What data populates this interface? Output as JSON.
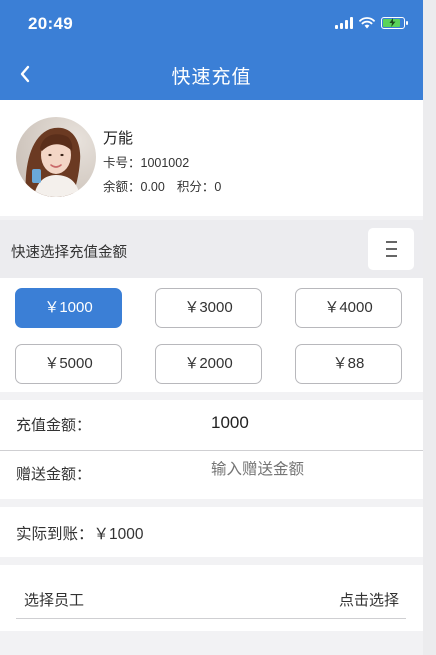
{
  "status_bar": {
    "time": "20:49",
    "icons": [
      "signal-icon",
      "wifi-icon",
      "battery-charging-icon"
    ]
  },
  "header": {
    "title": "快速充值",
    "back_icon": "chevron-left-icon",
    "color": "#3b7fd6"
  },
  "member": {
    "name": "万能",
    "card_no": "卡号：1001002",
    "balance": "余额：0.00",
    "points": "积分：0"
  },
  "quick_select": {
    "title": "快速选择充值金额",
    "menu_icon": "menu-lines-icon",
    "amounts": [
      "￥1000",
      "￥3000",
      "￥4000",
      "￥5000",
      "￥2000",
      "￥88"
    ],
    "selected_index": 0,
    "accent": "#3b7fd6"
  },
  "form": {
    "recharge_label": "充值金额：",
    "recharge_value": "1000",
    "gift_label": "赠送金额：",
    "gift_placeholder": "输入赠送金额",
    "actual_text": "实际到账：￥1000",
    "staff_label": "选择员工",
    "staff_action": "点击选择"
  }
}
